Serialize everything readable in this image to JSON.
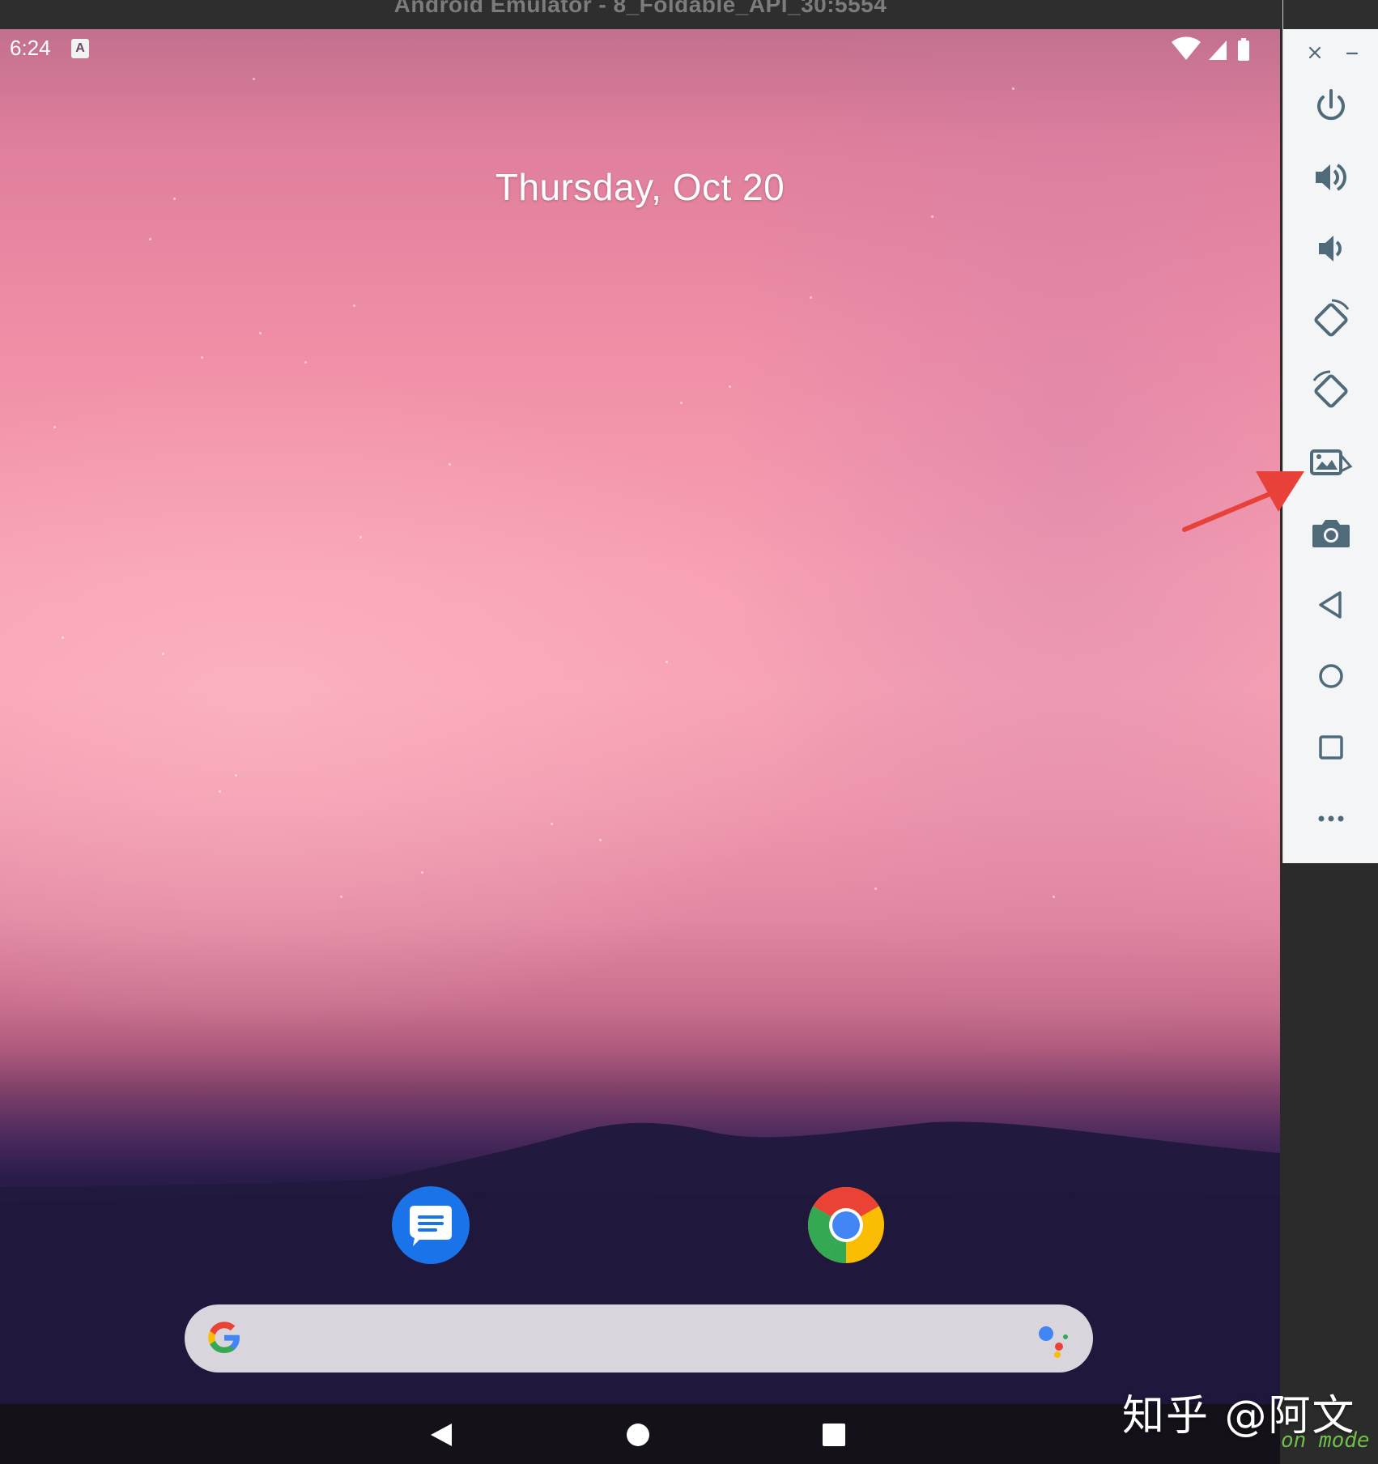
{
  "window": {
    "title": "Android Emulator - 8_Foldable_API_30:5554"
  },
  "status_bar": {
    "time": "6:24",
    "notification_icon": "A",
    "icons": [
      "wifi-icon",
      "cell-signal-icon",
      "battery-icon"
    ]
  },
  "home": {
    "date": "Thursday, Oct 20",
    "dock_apps": [
      "messages-app-icon",
      "chrome-app-icon"
    ],
    "search_bar": {
      "left_icon": "google-g-icon",
      "right_icon": "google-assistant-icon"
    }
  },
  "navigation_bar": {
    "buttons": [
      "back-icon",
      "home-icon",
      "recents-icon"
    ]
  },
  "emulator_toolbar": {
    "window_controls": [
      "close-icon",
      "minimize-icon"
    ],
    "buttons": [
      "power-icon",
      "volume-up-icon",
      "volume-down-icon",
      "rotate-left-icon",
      "rotate-right-icon",
      "screenshot-icon",
      "camera-icon",
      "back-triangle-icon",
      "home-circle-icon",
      "overview-square-icon",
      "more-dots-icon"
    ]
  },
  "annotation": {
    "arrow_color": "#e8413a"
  },
  "overlay": {
    "watermark": "知乎 @阿文",
    "terminal_text": "on mode"
  },
  "colors": {
    "toolbar_icon": "#4f6b7a",
    "messages_blue": "#1a73e8"
  }
}
